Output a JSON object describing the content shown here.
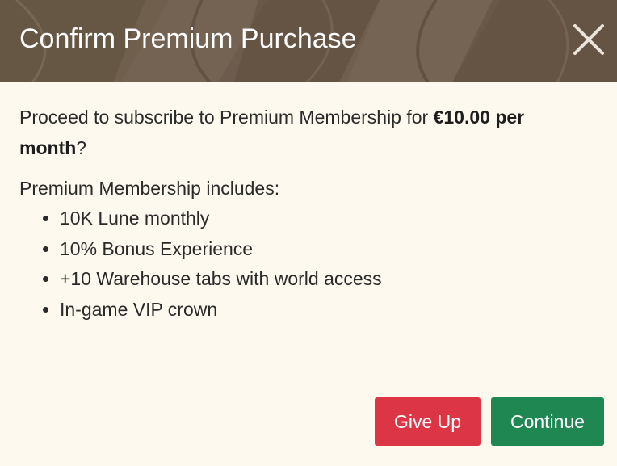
{
  "dialog": {
    "title": "Confirm Premium Purchase",
    "close_icon": "close-icon",
    "header_color": "#6b5a4b"
  },
  "body": {
    "lead_prefix": "Proceed to subscribe to Premium Membership for ",
    "lead_price": "€10.00 per month",
    "lead_suffix": "?",
    "includes_heading": "Premium Membership includes:",
    "benefits": [
      "10K Lune monthly",
      "10% Bonus Experience",
      "+10 Warehouse tabs with world access",
      "In-game VIP crown"
    ]
  },
  "footer": {
    "giveup_label": "Give Up",
    "continue_label": "Continue",
    "giveup_color": "#dc3545",
    "continue_color": "#1e8752"
  }
}
